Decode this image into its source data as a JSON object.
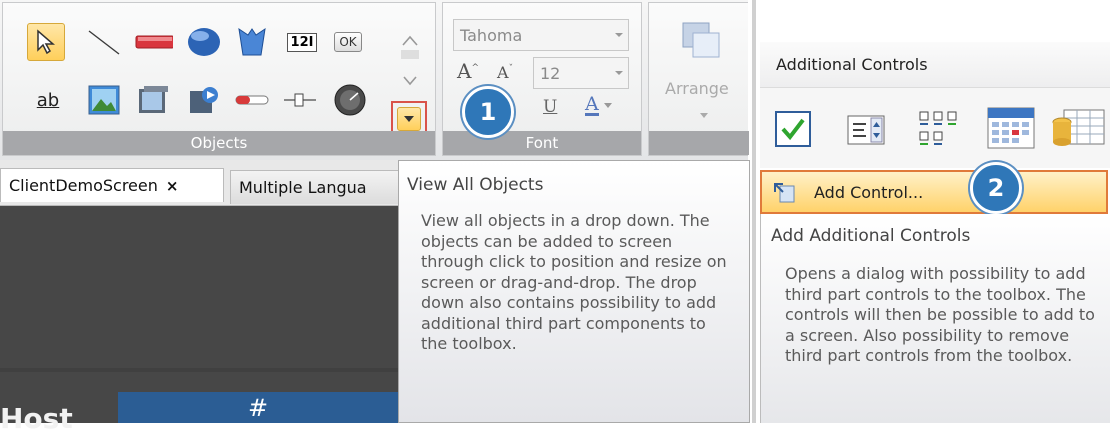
{
  "ribbon": {
    "objects_label": "Objects",
    "font_label": "Font",
    "arrange_label": "Arrange",
    "font_name": "Tahoma",
    "font_size": "12",
    "tool_text_label": "ab",
    "numeric_label": "12I",
    "ok_label": "OK",
    "underline_label": "U",
    "font_color_label": "A"
  },
  "tabs": {
    "client_demo": "ClientDemoScreen",
    "close_glyph": "×",
    "multiple_languages": "Multiple Langua"
  },
  "canvas": {
    "left_text": "Host",
    "header_text": "#"
  },
  "tooltip_objects": {
    "title": "View All Objects",
    "body": "View all objects in a drop down. The objects can be added to screen through click to position and resize on screen or drag-and-drop. The drop down also contains possibility to add additional third part components to the toolbox."
  },
  "badges": {
    "one": "1",
    "two": "2"
  },
  "additional_controls": {
    "header": "Additional Controls",
    "add_control_label": "Add Control...",
    "tooltip_title": "Add Additional Controls",
    "tooltip_body": "Opens a dialog with possibility to add third part controls to the toolbox. The controls will then be possible to add to a screen. Also possibility to remove third part controls from the toolbox."
  },
  "colors": {
    "highlight": "#ffd567",
    "highlight_border": "#d9534a",
    "badge_blue": "#2f77b8",
    "dark_canvas": "#474747",
    "header_blue": "#2b5d94"
  }
}
